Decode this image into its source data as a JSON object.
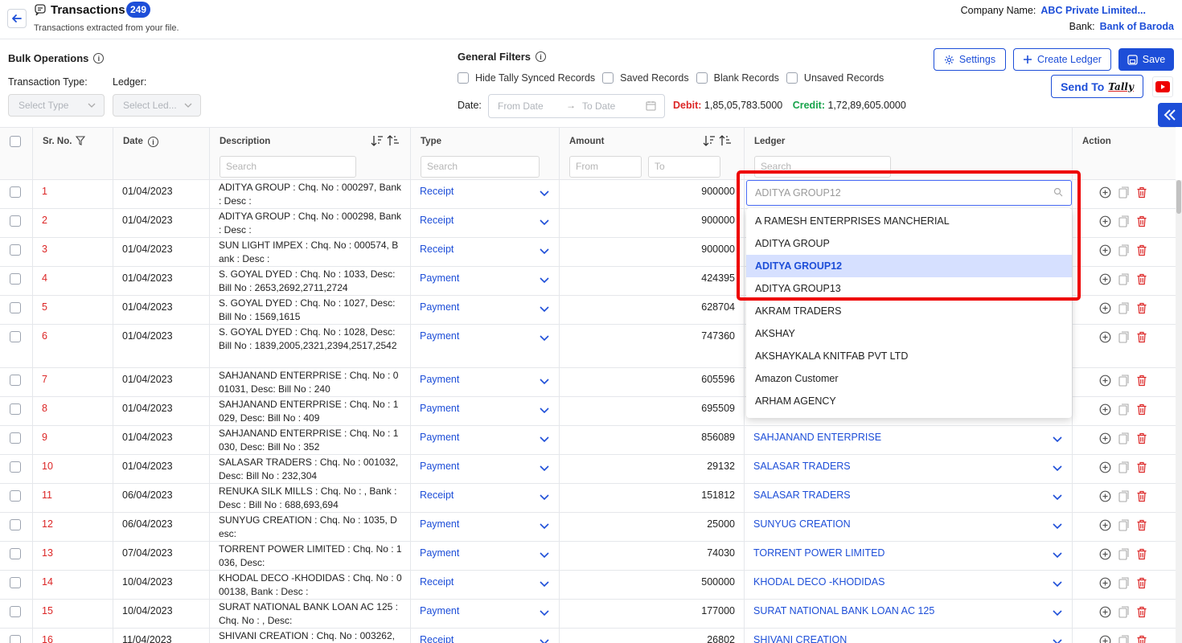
{
  "header": {
    "title": "Transactions",
    "count": "249",
    "subtitle": "Transactions extracted from your file.",
    "company_label": "Company Name:",
    "company_value": "ABC Private Limited...",
    "bank_label": "Bank:",
    "bank_value": "Bank of Baroda"
  },
  "bulk": {
    "title": "Bulk Operations",
    "type_label": "Transaction Type:",
    "ledger_label": "Ledger:",
    "type_placeholder": "Select Type",
    "ledger_placeholder": "Select Led..."
  },
  "filters": {
    "title": "General Filters",
    "checkboxes": [
      "Hide Tally Synced Records",
      "Saved Records",
      "Blank Records",
      "Unsaved Records"
    ],
    "date_label": "Date:",
    "from_placeholder": "From Date",
    "to_placeholder": "To Date",
    "debit_label": "Debit:",
    "debit_value": "1,85,05,783.5000",
    "credit_label": "Credit:",
    "credit_value": "1,72,89,605.0000"
  },
  "buttons": {
    "settings": "Settings",
    "create_ledger": "Create Ledger",
    "save": "Save",
    "send_to": "Send To",
    "tally": "Tally"
  },
  "columns": {
    "sr": "Sr. No.",
    "date": "Date",
    "description": "Description",
    "type": "Type",
    "amount": "Amount",
    "ledger": "Ledger",
    "action": "Action",
    "search_placeholder": "Search",
    "from_placeholder": "From",
    "to_placeholder": "To"
  },
  "rows": [
    {
      "sr": "1",
      "date": "01/04/2023",
      "desc": "ADITYA GROUP : Chq. No : 000297, Bank : Desc :",
      "type": "Receipt",
      "amount": "900000",
      "ledger": ""
    },
    {
      "sr": "2",
      "date": "01/04/2023",
      "desc": "ADITYA GROUP : Chq. No : 000298, Bank : Desc :",
      "type": "Receipt",
      "amount": "900000",
      "ledger": ""
    },
    {
      "sr": "3",
      "date": "01/04/2023",
      "desc": "SUN LIGHT IMPEX : Chq. No : 000574, Bank : Desc :",
      "type": "Receipt",
      "amount": "900000",
      "ledger": ""
    },
    {
      "sr": "4",
      "date": "01/04/2023",
      "desc": "S. GOYAL DYED : Chq. No : 1033, Desc: Bill No : 2653,2692,2711,2724",
      "type": "Payment",
      "amount": "424395",
      "ledger": ""
    },
    {
      "sr": "5",
      "date": "01/04/2023",
      "desc": "S. GOYAL DYED : Chq. No : 1027, Desc: Bill No : 1569,1615",
      "type": "Payment",
      "amount": "628704",
      "ledger": ""
    },
    {
      "sr": "6",
      "date": "01/04/2023",
      "desc": "S. GOYAL DYED : Chq. No : 1028, Desc: Bill No : 1839,2005,2321,2394,2517,2542",
      "type": "Payment",
      "amount": "747360",
      "ledger": ""
    },
    {
      "sr": "7",
      "date": "01/04/2023",
      "desc": "SAHJANAND ENTERPRISE : Chq. No : 001031, Desc: Bill No : 240",
      "type": "Payment",
      "amount": "605596",
      "ledger": ""
    },
    {
      "sr": "8",
      "date": "01/04/2023",
      "desc": "SAHJANAND ENTERPRISE : Chq. No : 1029, Desc: Bill No : 409",
      "type": "Payment",
      "amount": "695509",
      "ledger": ""
    },
    {
      "sr": "9",
      "date": "01/04/2023",
      "desc": "SAHJANAND ENTERPRISE : Chq. No : 1030, Desc: Bill No : 352",
      "type": "Payment",
      "amount": "856089",
      "ledger": "SAHJANAND ENTERPRISE"
    },
    {
      "sr": "10",
      "date": "01/04/2023",
      "desc": "SALASAR TRADERS : Chq. No : 001032, Desc: Bill No : 232,304",
      "type": "Payment",
      "amount": "29132",
      "ledger": "SALASAR TRADERS"
    },
    {
      "sr": "11",
      "date": "06/04/2023",
      "desc": "RENUKA SILK MILLS : Chq. No : , Bank : Desc : Bill No : 688,693,694",
      "type": "Receipt",
      "amount": "151812",
      "ledger": "SALASAR TRADERS"
    },
    {
      "sr": "12",
      "date": "06/04/2023",
      "desc": "SUNYUG CREATION : Chq. No : 1035, Desc:",
      "type": "Payment",
      "amount": "25000",
      "ledger": "SUNYUG CREATION"
    },
    {
      "sr": "13",
      "date": "07/04/2023",
      "desc": "TORRENT POWER LIMITED : Chq. No : 1036, Desc:",
      "type": "Payment",
      "amount": "74030",
      "ledger": "TORRENT POWER LIMITED"
    },
    {
      "sr": "14",
      "date": "10/04/2023",
      "desc": "KHODAL DECO -KHODIDAS : Chq. No : 000138, Bank : Desc :",
      "type": "Receipt",
      "amount": "500000",
      "ledger": "KHODAL DECO -KHODIDAS"
    },
    {
      "sr": "15",
      "date": "10/04/2023",
      "desc": "SURAT NATIONAL BANK LOAN AC 125 : Chq. No : , Desc:",
      "type": "Payment",
      "amount": "177000",
      "ledger": "SURAT NATIONAL BANK LOAN AC 125"
    },
    {
      "sr": "16",
      "date": "11/04/2023",
      "desc": "SHIVANI CREATION : Chq. No : 003262,",
      "type": "Receipt",
      "amount": "26802",
      "ledger": "SHIVANI CREATION"
    }
  ],
  "ledger_dropdown": {
    "current_value": "ADITYA GROUP12",
    "options": [
      "A RAMESH ENTERPRISES MANCHERIAL",
      "ADITYA GROUP",
      "ADITYA GROUP12",
      "ADITYA GROUP13",
      "AKRAM TRADERS",
      "AKSHAY",
      "AKSHAYKALA KNITFAB PVT LTD",
      "Amazon Customer",
      "ARHAM AGENCY"
    ],
    "selected": "ADITYA GROUP12"
  },
  "colors": {
    "accent": "#1d4ed8",
    "debit": "#dc2626",
    "credit": "#16a34a",
    "highlight": "#e00000"
  }
}
